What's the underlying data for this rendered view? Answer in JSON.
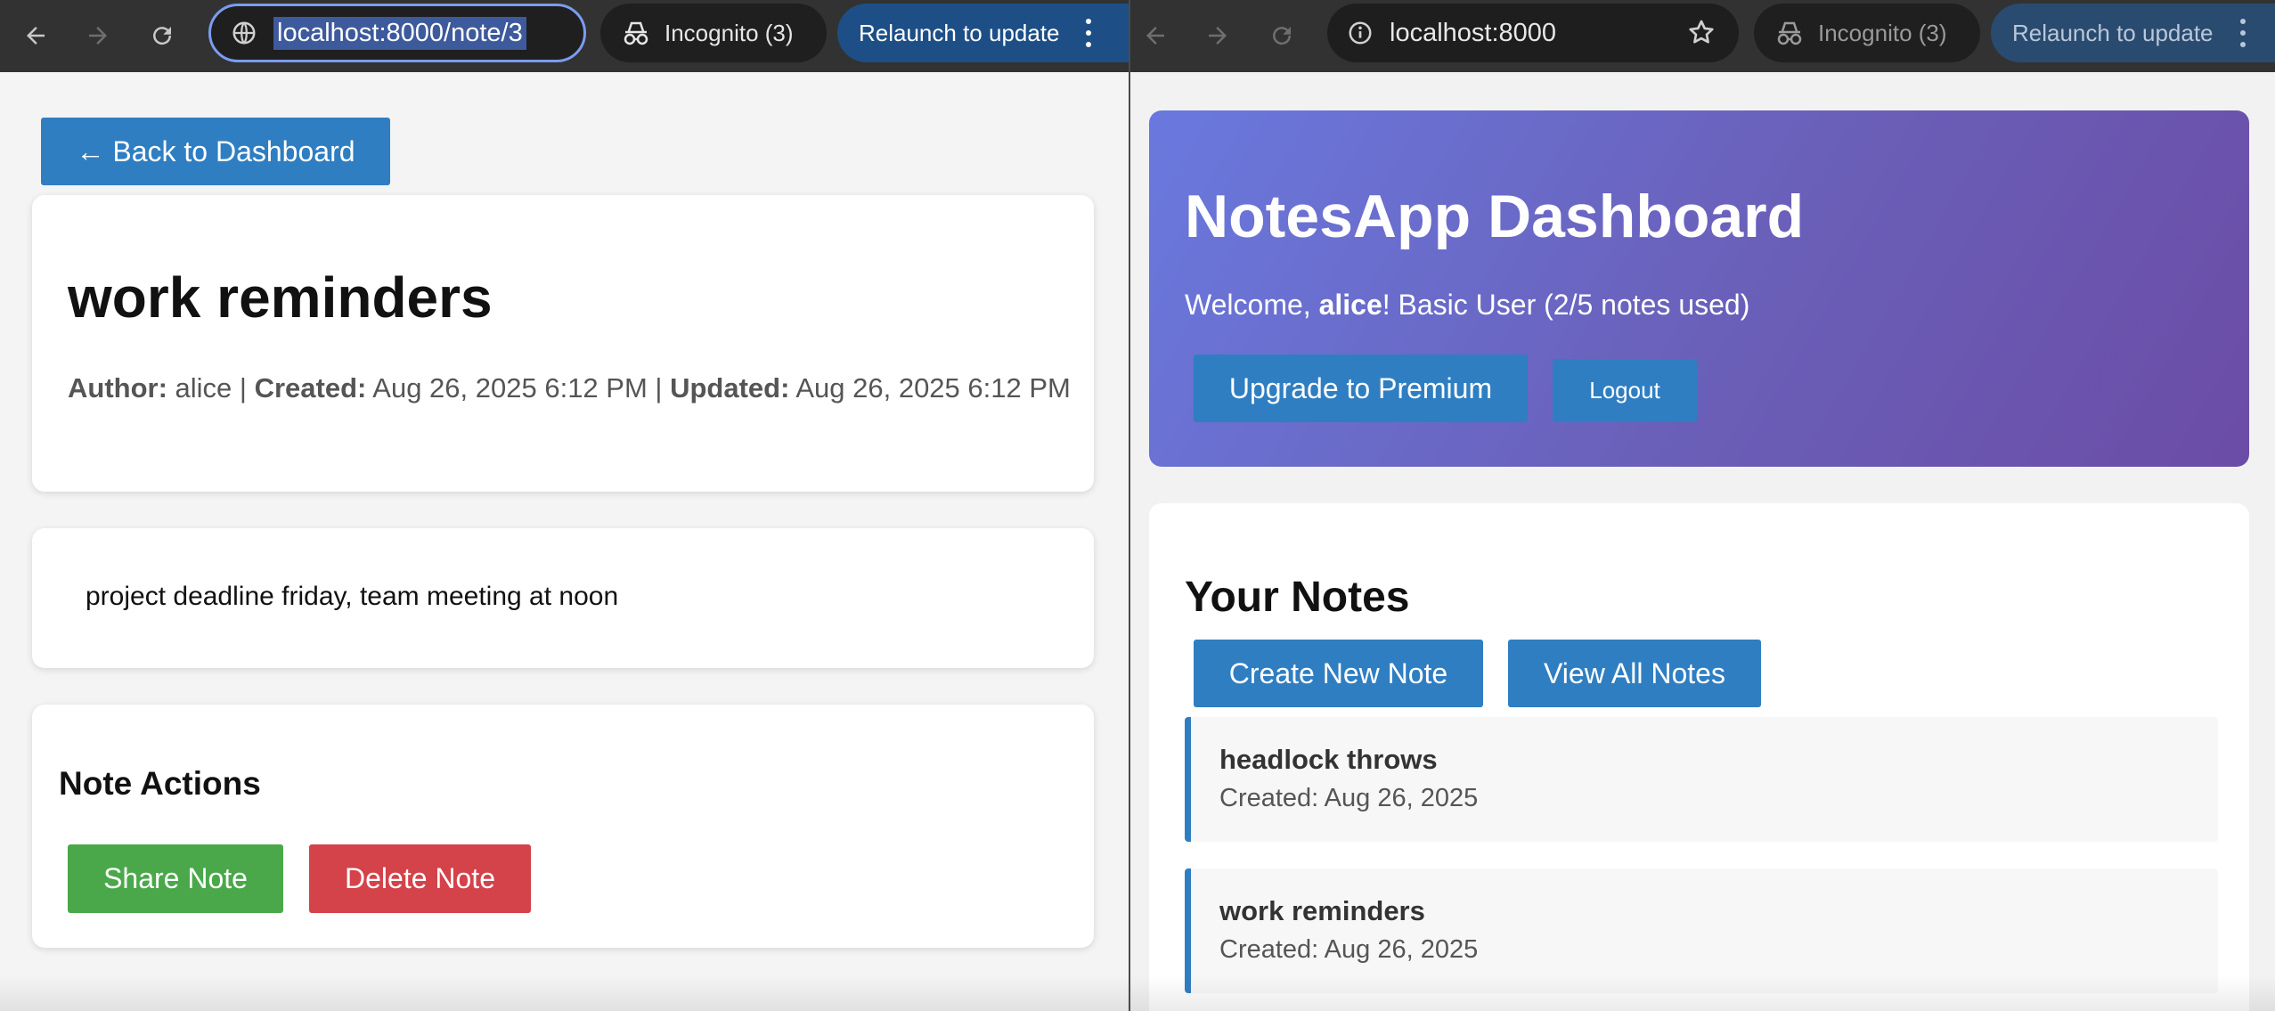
{
  "left_browser": {
    "url": "localhost:8000/note/3",
    "incognito_label": "Incognito (3)",
    "relaunch_label": "Relaunch to update"
  },
  "right_browser": {
    "url": "localhost:8000",
    "incognito_label": "Incognito (3)",
    "relaunch_label": "Relaunch to update"
  },
  "note_page": {
    "back_label": "← Back to Dashboard",
    "title": "work reminders",
    "meta": {
      "author_label": "Author:",
      "author": "alice",
      "sep1": "|",
      "created_label": "Created:",
      "created": "Aug 26, 2025 6:12 PM",
      "sep2": "|",
      "updated_label": "Updated:",
      "updated": "Aug 26, 2025 6:12 PM"
    },
    "content": "project deadline friday, team meeting at noon",
    "actions_title": "Note Actions",
    "share_label": "Share Note",
    "delete_label": "Delete Note"
  },
  "dashboard": {
    "title": "NotesApp Dashboard",
    "welcome_prefix": "Welcome, ",
    "username": "alice",
    "welcome_suffix": "! Basic User (2/5 notes used)",
    "upgrade_label": "Upgrade to Premium",
    "logout_label": "Logout",
    "notes_title": "Your Notes",
    "create_label": "Create New Note",
    "view_all_label": "View All Notes",
    "notes": [
      {
        "title": "headlock throws",
        "created": "Created: Aug 26, 2025"
      },
      {
        "title": "work reminders",
        "created": "Created: Aug 26, 2025"
      }
    ]
  },
  "colors": {
    "primary_blue": "#2f7ec2",
    "success_green": "#4aa84a",
    "danger_red": "#d4424a",
    "hero_gradient_start": "#6a79de",
    "hero_gradient_end": "#6b4ca6"
  }
}
